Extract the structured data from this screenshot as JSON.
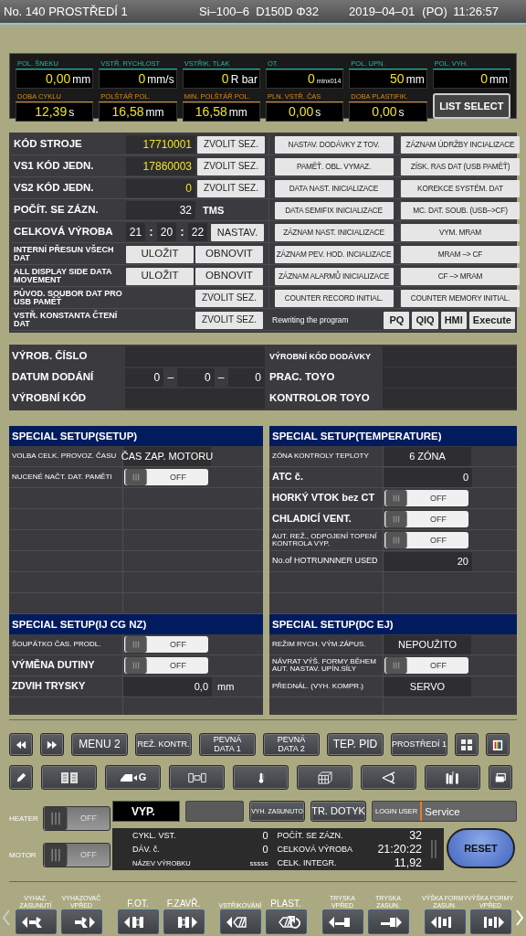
{
  "title_bar": {
    "screen": "No. 140 PROSTŘEDÍ 1",
    "machine": "Si–100–6  D150D Φ32",
    "date": "2019–04–01",
    "weekday": "(PO)",
    "time": "11:26:57"
  },
  "monitor": {
    "rows": [
      {
        "color": "#22b8a6",
        "items": [
          {
            "label": "POL. ŠNEKU",
            "value": "0,00",
            "unit": "mm"
          },
          {
            "label": "VSTŘ. RYCHLOST",
            "value": "0",
            "unit": "mm/s"
          },
          {
            "label": "VSTŘIK. TLAK",
            "value": "0",
            "unit": "R bar"
          },
          {
            "label": "OT.",
            "value": "0",
            "unit": "minx014"
          },
          {
            "label": "POL. UPN.",
            "value": "50",
            "unit": "mm"
          },
          {
            "label": "POL. VYH.",
            "value": "0",
            "unit": "mm"
          }
        ]
      },
      {
        "color": "#d98a1c",
        "items": [
          {
            "label": "DOBA CYKLU",
            "value": "12,39",
            "unit": "s"
          },
          {
            "label": "POLŠTÁŘ POL.",
            "value": "16,58",
            "unit": "mm"
          },
          {
            "label": "MIN. POLŠTÁŘ POL.",
            "value": "16,58",
            "unit": "mm"
          },
          {
            "label": "PLN. VSTŘ. ČAS",
            "value": "0,00",
            "unit": "s"
          },
          {
            "label": "DOBA PLASTIFIK.",
            "value": "0,00",
            "unit": "s"
          }
        ]
      }
    ],
    "list_select": "LIST SELECT"
  },
  "settings": {
    "rows": [
      {
        "label": "KÓD STROJE",
        "kind": "code",
        "value": "17710001",
        "button": "ZVOLIT SEZ.",
        "actions": [
          "NASTAV. DODÁVKY Z TOV.",
          "ZÁZNAM ÚDRŽBY INCIALIZACE"
        ]
      },
      {
        "label": "VS1 KÓD JEDN.",
        "kind": "code",
        "value": "17860003",
        "button": "ZVOLIT SEZ.",
        "actions": [
          "PAMĚŤ. OBL. VYMAZ.",
          "ZÍSK. RAS DAT (USB PAMĚŤ)"
        ]
      },
      {
        "label": "VS2 KÓD JEDN.",
        "kind": "code",
        "value": "0",
        "button": "ZVOLIT SEZ.",
        "actions": [
          "DATA NAST. INICIALIZACE",
          "KOREKCE SYSTÉM. DAT"
        ]
      },
      {
        "label": "POČÍT. SE ZÁZN.",
        "kind": "count",
        "value": "32",
        "unit": "TMS",
        "actions": [
          "DATA SEMIFIX INICIALIZACE",
          "MC. DAT. SOUB. (USB–>CF)"
        ]
      },
      {
        "label": "CELKOVÁ VÝROBA",
        "kind": "time",
        "parts": [
          "21",
          "20",
          "22"
        ],
        "separators": [
          ":",
          ":"
        ],
        "button": "NASTAV.",
        "actions": [
          "ZÁZNAM NAST. INICIALIZACE",
          "VYM. MRAM"
        ]
      },
      {
        "label": "INTERNÍ PŘESUN VŠECH DAT",
        "kind": "pair",
        "buttons": [
          "ULOŽIT",
          "OBNOVIT"
        ],
        "actions": [
          "ZÁZNAM PEV. HOD. INCIALIZACE",
          "MRAM –> CF"
        ]
      },
      {
        "label": "ALL DISPLAY SIDE DATA MOVEMENT",
        "kind": "pair",
        "buttons": [
          "ULOŽIT",
          "OBNOVIT"
        ],
        "actions": [
          "ZÁZNAM ALARMŮ INICIALIZACE",
          "CF –> MRAM"
        ]
      },
      {
        "label": "PŮVOD. SOUBOR DAT PRO USB PAMĚŤ",
        "kind": "select",
        "button": "ZVOLIT SEZ.",
        "actions": [
          "COUNTER RECORD INITIAL.",
          "COUNTER MEMORY INITIAL."
        ]
      },
      {
        "label": "VSTŘ. KONSTANTA ČTENÍ DAT",
        "kind": "select",
        "button": "ZVOLIT SEZ.",
        "rewrite": {
          "label": "Rewriting the program",
          "buttons": [
            "PQ",
            "QIQ",
            "HMI",
            "Execute"
          ]
        }
      }
    ]
  },
  "production": {
    "rows": [
      {
        "label": "VÝROB. ČÍSLO",
        "right_label": "VÝROBNÍ KÓD DODÁVKY"
      },
      {
        "label": "DATUM DODÁNÍ",
        "date": [
          "0",
          "0",
          "0"
        ],
        "separators": [
          "–",
          "–"
        ],
        "right_label": "PRAC. TOYO"
      },
      {
        "label": "VÝROBNÍ KÓD",
        "right_label": "KONTROLOR TOYO"
      }
    ]
  },
  "panels": [
    {
      "title": "SPECIAL SETUP(SETUP)",
      "rows": [
        {
          "kind": "choice",
          "label": "VOLBA CELK. PROVOZ. ČASU",
          "value": "ČAS ZAP. MOTORU"
        },
        {
          "kind": "toggle",
          "label": "NUCENÉ NAČT. DAT. PAMĚTI",
          "on": false,
          "state": "OFF"
        },
        {
          "kind": "blank"
        },
        {
          "kind": "blank"
        },
        {
          "kind": "blank"
        },
        {
          "kind": "blank"
        },
        {
          "kind": "blank"
        },
        {
          "kind": "blank"
        }
      ]
    },
    {
      "title": "SPECIAL SETUP(TEMPERATURE)",
      "rows": [
        {
          "kind": "choice",
          "label": "ZÓNA KONTROLY TEPLOTY",
          "value": "6 ZÓNA"
        },
        {
          "kind": "number",
          "label": "ATC č.",
          "value": "0"
        },
        {
          "kind": "toggle",
          "label": "HORKÝ VTOK bez CT",
          "on": false,
          "state": "OFF"
        },
        {
          "kind": "toggle",
          "label": "CHLADICÍ VENT.",
          "on": false,
          "state": "OFF"
        },
        {
          "kind": "toggle",
          "label": "AUT. REŽ., ODPOJENÍ TOPENÍ KONTROLA VYP.",
          "on": false,
          "state": "OFF"
        },
        {
          "kind": "number",
          "label": "No.of HOTRUNNNER USED",
          "value": "20"
        },
        {
          "kind": "blank"
        },
        {
          "kind": "blank"
        }
      ]
    },
    {
      "title": "SPECIAL SETUP(IJ CG NZ)",
      "rows": [
        {
          "kind": "toggle",
          "label": "ŠOUPÁTKO ČAS. PRODL.",
          "on": false,
          "state": "OFF"
        },
        {
          "kind": "toggle",
          "label": "VÝMĚNA DUTINY",
          "on": false,
          "state": "OFF"
        },
        {
          "kind": "number",
          "label": "ZDVIH TRYSKY",
          "value": "0,0",
          "unit": "mm"
        },
        {
          "kind": "blank"
        }
      ]
    },
    {
      "title": "SPECIAL SETUP(DC EJ)",
      "rows": [
        {
          "kind": "choice",
          "label": "REŽIM RYCH. VÝM.ZÁPUS.",
          "value": "NEPOUŽITO"
        },
        {
          "kind": "toggle",
          "label": "NÁVRAT VÝŠ. FORMY BĚHEM AUT. NASTAV. UPÍN.SÍLY",
          "on": false,
          "state": "OFF"
        },
        {
          "kind": "choice",
          "label": "PŘEDNÁL. (VYH. KOMPR.)",
          "value": "SERVO"
        },
        {
          "kind": "blank"
        }
      ]
    }
  ],
  "nav_buttons": [
    {
      "kind": "rewind"
    },
    {
      "kind": "forward"
    },
    {
      "kind": "text",
      "label": "MENU 2"
    },
    {
      "kind": "text",
      "label": "REŽ. KONTR."
    },
    {
      "kind": "text",
      "label": "PEVNÁ\nDATA 1"
    },
    {
      "kind": "text",
      "label": "PEVNÁ\nDATA 2"
    },
    {
      "kind": "text",
      "label": "TEP. PID"
    },
    {
      "kind": "text",
      "label": "PROSTŘEDÍ 1"
    },
    {
      "kind": "grid"
    },
    {
      "kind": "book"
    }
  ],
  "tool_buttons": [
    {
      "kind": "pencil"
    },
    {
      "kind": "manual"
    },
    {
      "kind": "inject",
      "label": "G"
    },
    {
      "kind": "mold"
    },
    {
      "kind": "thermometer"
    },
    {
      "kind": "cubes"
    },
    {
      "kind": "eye"
    },
    {
      "kind": "split"
    },
    {
      "kind": "window"
    }
  ],
  "status": {
    "mode": "VYP.",
    "retract": "VYH. ZASUNUTO",
    "touch": "TR. DOTYK",
    "login_label": "LOGIN USER",
    "login_value": "Service"
  },
  "switches": [
    {
      "label": "HEATER",
      "on": false,
      "state": "OFF"
    },
    {
      "label": "MOTOR",
      "on": false,
      "state": "OFF"
    }
  ],
  "counters": {
    "left": [
      {
        "label": "CYKL. VST.",
        "value": "0"
      },
      {
        "label": "DÁV. č.",
        "value": "0"
      },
      {
        "label": "NÁZEV VÝROBKU",
        "value": "sssss"
      }
    ],
    "right": [
      {
        "label": "POČÍT. SE ZÁZN.",
        "value": "32"
      },
      {
        "label": "CELKOVÁ VÝROBA",
        "value": "21:20:22"
      },
      {
        "label": "CELK. INTEGR.",
        "value": "11,92"
      }
    ]
  },
  "reset": "RESET",
  "jog": [
    {
      "kind": "eject-back",
      "caption": "VYHAZ.\nZASUNUTÍ"
    },
    {
      "kind": "eject-fwd",
      "caption": "VYHAZOVAČ\nVPŘED"
    },
    {
      "kind": "open",
      "caption": "F.OT."
    },
    {
      "kind": "close",
      "caption": "F.ZAVŘ."
    },
    {
      "kind": "inject",
      "caption": "VSTŘIKOVÁNÍ"
    },
    {
      "kind": "plast",
      "caption": "PLAST."
    },
    {
      "kind": "nozzle-fwd",
      "caption": "TRYSKA\nVPŘED"
    },
    {
      "kind": "nozzle-back",
      "caption": "TRYSKA\nZASUN."
    },
    {
      "kind": "mold-back",
      "caption": "VÝŠKA FORMY\nZASUN."
    },
    {
      "kind": "mold-fwd",
      "caption": "VÝŠKA FORMY\nVPŘED"
    }
  ]
}
